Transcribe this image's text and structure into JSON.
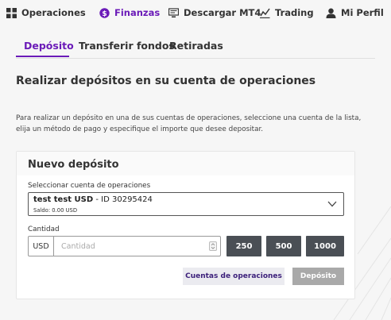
{
  "nav": {
    "items": [
      {
        "label": "Operaciones",
        "icon": "grid-icon",
        "active": false
      },
      {
        "label": "Finanzas",
        "icon": "dollar-circle-icon",
        "active": true
      },
      {
        "label": "Descargar MT4",
        "icon": "monitor-icon",
        "active": false
      },
      {
        "label": "Trading",
        "icon": "chart-icon",
        "active": false
      },
      {
        "label": "Mi Perfil",
        "icon": "user-icon",
        "active": false
      }
    ]
  },
  "tabs": [
    {
      "label": "Depósito",
      "active": true
    },
    {
      "label": "Transferir fondos",
      "active": false
    },
    {
      "label": "Retiradas",
      "active": false
    }
  ],
  "page": {
    "title": "Realizar depósitos en su cuenta de operaciones",
    "description": "Para realizar un depósito en una de sus cuentas de operaciones, seleccione una cuenta de la lista, elija un método de pago y especifique el importe que desee depositar."
  },
  "deposit_form": {
    "title": "Nuevo depósito",
    "account_label": "Seleccionar cuenta de operaciones",
    "account_name": "test test USD",
    "account_id": " - ID 30295424",
    "account_balance": "Saldo: 0.00 USD",
    "amount_label": "Cantidad",
    "currency": "USD",
    "amount_placeholder": "Cantidad",
    "amount_value": "",
    "quick_amounts": [
      "250",
      "500",
      "1000"
    ],
    "accounts_button": "Cuentas de operaciones",
    "deposit_button": "Depósito"
  },
  "colors": {
    "accent": "#6b1bb8",
    "quick_button_bg": "#4a4f55",
    "disabled_button_bg": "#a9a9a9"
  }
}
